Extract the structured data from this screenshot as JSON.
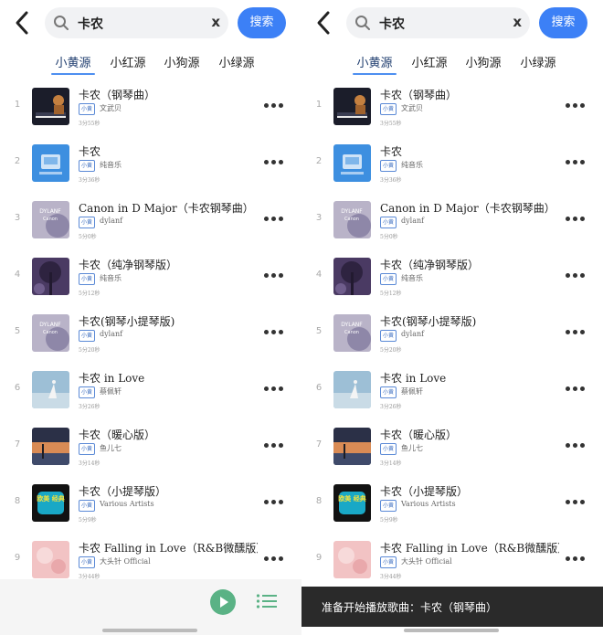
{
  "search": {
    "query": "卡农",
    "clear_label": "x",
    "button_label": "搜索"
  },
  "tabs": [
    "小黄源",
    "小红源",
    "小狗源",
    "小绿源"
  ],
  "source_badge": "小黄",
  "songs": [
    {
      "index": "1",
      "title": "卡农（钢琴曲）",
      "artist": "文武贝",
      "duration": "3分55秒"
    },
    {
      "index": "2",
      "title": "卡农",
      "artist": "纯音乐",
      "duration": "3分36秒"
    },
    {
      "index": "3",
      "title": "Canon in D Major（卡农钢琴曲）",
      "artist": "dylanf",
      "duration": "5分0秒"
    },
    {
      "index": "4",
      "title": "卡农（纯净钢琴版）",
      "artist": "纯音乐",
      "duration": "5分12秒"
    },
    {
      "index": "5",
      "title": "卡农(钢琴小提琴版)",
      "artist": "dylanf",
      "duration": "5分20秒"
    },
    {
      "index": "6",
      "title": "卡农 in Love",
      "artist": "蔡佩轩",
      "duration": "3分26秒"
    },
    {
      "index": "7",
      "title": "卡农（暖心版）",
      "artist": "鱼儿七",
      "duration": "3分14秒"
    },
    {
      "index": "8",
      "title": "卡农（小提琴版）",
      "artist": "Various Artists",
      "duration": "5分9秒"
    },
    {
      "index": "9",
      "title": "卡农 Falling in Love（R&B微醺版）",
      "artist": "大头针 Official",
      "duration": "3分44秒"
    }
  ],
  "cover_art_text": {
    "album_a": "DYLANF",
    "album_a_sub": "Canon",
    "album_b": "欧美 经典"
  },
  "toast": {
    "message": "准备开始播放歌曲：卡农（钢琴曲）"
  },
  "colors": {
    "accent": "#3c80f6",
    "play": "#5ab285",
    "toast_bg": "#2a2a2a"
  }
}
